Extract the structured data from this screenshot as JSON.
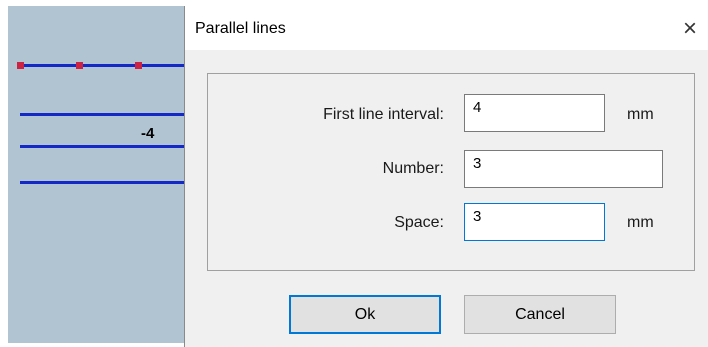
{
  "canvas": {
    "dimension_label": "-4",
    "line_color": "#1428c8",
    "vertex_color": "#cc2244",
    "background_color": "#b0c4d2"
  },
  "dialog": {
    "title": "Parallel lines",
    "close_icon": "×",
    "fields": {
      "first_line_interval": {
        "label": "First line interval:",
        "value": "4",
        "unit": "mm"
      },
      "number": {
        "label": "Number:",
        "value": "3"
      },
      "space": {
        "label": "Space:",
        "value": "3",
        "unit": "mm"
      }
    },
    "ok_label": "Ok",
    "cancel_label": "Cancel",
    "focus_color": "#0078d7"
  }
}
